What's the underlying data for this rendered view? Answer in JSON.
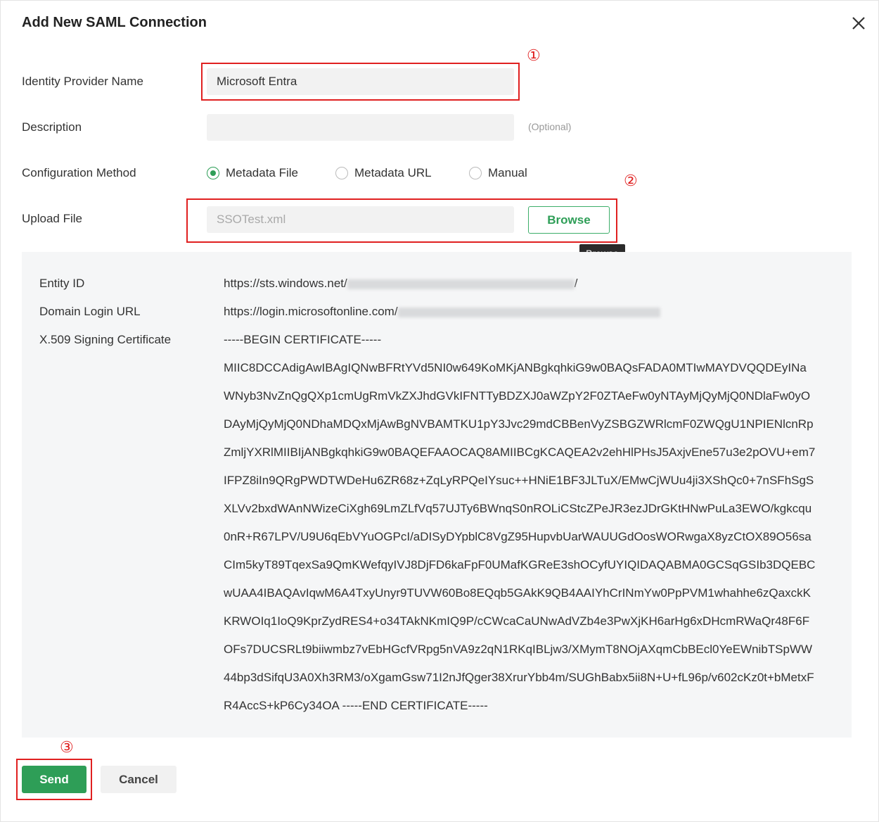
{
  "dialog": {
    "title": "Add New SAML Connection",
    "close_icon": "close-icon"
  },
  "form": {
    "idp_name_label": "Identity Provider Name",
    "idp_name_value": "Microsoft Entra",
    "description_label": "Description",
    "description_value": "",
    "optional_hint": "(Optional)",
    "config_method_label": "Configuration Method",
    "config_methods": [
      {
        "label": "Metadata File",
        "selected": true
      },
      {
        "label": "Metadata URL",
        "selected": false
      },
      {
        "label": "Manual",
        "selected": false
      }
    ],
    "upload_label": "Upload File",
    "upload_value": "SSOTest.xml",
    "browse_label": "Browse",
    "browse_tooltip": "Browse"
  },
  "metadata": {
    "entity_id_label": "Entity ID",
    "entity_id_prefix": "https://sts.windows.net/",
    "entity_id_suffix": "/",
    "login_url_label": "Domain Login URL",
    "login_url_prefix": "https://login.microsoftonline.com/",
    "cert_label": "X.509 Signing Certificate",
    "cert_lines": [
      "-----BEGIN CERTIFICATE-----",
      "MIIC8DCCAdigAwIBAgIQNwBFRtYVd5NI0w649KoMKjANBgkqhkiG9w0BAQsFADA0MTIwMAYDVQQDEyINa",
      "WNyb3NvZnQgQXp1cmUgRmVkZXJhdGVkIFNTTyBDZXJ0aWZpY2F0ZTAeFw0yNTAyMjQyMjQ0NDlaFw0yO",
      "DAyMjQyMjQ0NDhaMDQxMjAwBgNVBAMTKU1pY3Jvc29mdCBBenVyZSBGZWRlcmF0ZWQgU1NPIENlcnRp",
      "ZmljYXRlMIIBIjANBgkqhkiG9w0BAQEFAAOCAQ8AMIIBCgKCAQEA2v2ehHlPHsJ5AxjvEne57u3e2pOVU+em7",
      "IFPZ8iIn9QRgPWDTWDeHu6ZR68z+ZqLyRPQeIYsuc++HNiE1BF3JLTuX/EMwCjWUu4ji3XShQc0+7nSFhSgS",
      "XLVv2bxdWAnNWizeCiXgh69LmZLfVq57UJTy6BWnqS0nROLiCStcZPeJR3ezJDrGKtHNwPuLa3EWO/kgkcqu",
      "0nR+R67LPV/U9U6qEbVYuOGPcI/aDISyDYpblC8VgZ95HupvbUarWAUUGdOosWORwgaX8yzCtOX89O56sa",
      "CIm5kyT89TqexSa9QmKWefqyIVJ8DjFD6kaFpF0UMafKGReE3shOCyfUYIQIDAQABMA0GCSqGSIb3DQEBC",
      "wUAA4IBAQAvIqwM6A4TxyUnyr9TUVW60Bo8EQqb5GAkK9QB4AAIYhCrINmYw0PpPVM1whahhe6zQaxckK",
      "KRWOIq1IoQ9KprZydRES4+o34TAkNKmIQ9P/cCWcaCaUNwAdVZb4e3PwXjKH6arHg6xDHcmRWaQr48F6F",
      "OFs7DUCSRLt9biiwmbz7vEbHGcfVRpg5nVA9z2qN1RKqIBLjw3/XMymT8NOjAXqmCbBEcl0YeEWnibTSpWW",
      "44bp3dSifqU3A0Xh3RM3/oXgamGsw71I2nJfQger38XrurYbb4m/SUGhBabx5ii8N+U+fL96p/v602cKz0t+bMetxF",
      "R4AccS+kP6Cy34OA -----END CERTIFICATE-----"
    ]
  },
  "markers": [
    "①",
    "②",
    "③"
  ],
  "footer": {
    "send_label": "Send",
    "cancel_label": "Cancel"
  },
  "colors": {
    "accent": "#2e9e57",
    "annotation_red": "#e02020"
  }
}
